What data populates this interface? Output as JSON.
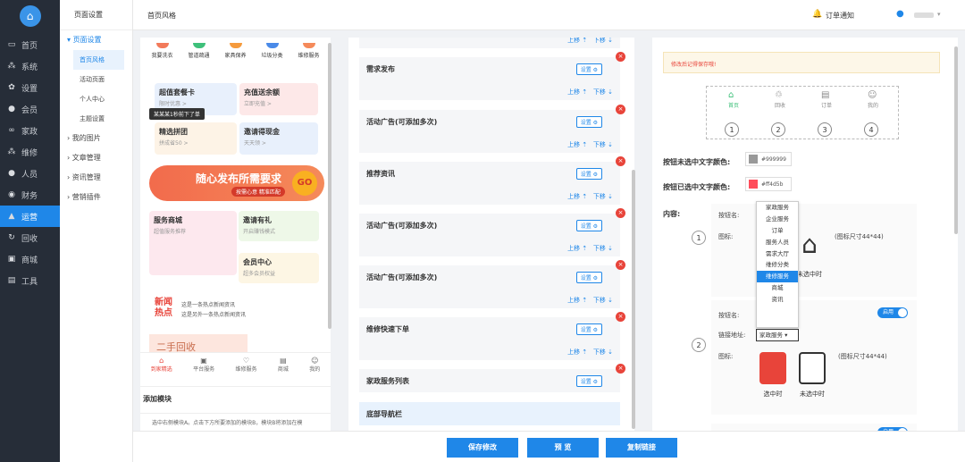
{
  "sidebar": {
    "items": [
      {
        "label": "首页",
        "icon": "monitor-icon"
      },
      {
        "label": "系统",
        "icon": "network-icon"
      },
      {
        "label": "设置",
        "icon": "gear-icon"
      },
      {
        "label": "会员",
        "icon": "user-icon"
      },
      {
        "label": "家政",
        "icon": "link-icon"
      },
      {
        "label": "维修",
        "icon": "network-icon"
      },
      {
        "label": "人员",
        "icon": "user-icon"
      },
      {
        "label": "财务",
        "icon": "finance-icon"
      },
      {
        "label": "运营",
        "icon": "chart-icon",
        "active": true
      },
      {
        "label": "回收",
        "icon": "recycle-icon"
      },
      {
        "label": "商城",
        "icon": "shop-icon"
      },
      {
        "label": "工具",
        "icon": "toolbox-icon"
      }
    ]
  },
  "subnav": {
    "header": "页面设置",
    "group_open": "页面设置",
    "sub_items": [
      "首页风格",
      "活动页面",
      "个人中心",
      "主题设置"
    ],
    "groups": [
      "我的图片",
      "文章管理",
      "资讯管理",
      "营销插件"
    ]
  },
  "topbar": {
    "title": "首页风格",
    "notice": "订单通知"
  },
  "preview": {
    "icons": [
      "我要洗衣",
      "管道疏通",
      "家具保养",
      "垃圾分类",
      "维修服务"
    ],
    "cards": [
      {
        "title": "超值套餐卡",
        "sub": "限时优惠 >"
      },
      {
        "title": "充值送余额",
        "sub": "立即充值 >"
      },
      {
        "title": "精选拼团",
        "sub": "拼成省50 >"
      },
      {
        "title": "邀请得现金",
        "sub": "天天领 >"
      }
    ],
    "tip": "某某某1秒前下了单",
    "banner_title": "随心发布所需要求",
    "banner_sub": "按需心意 精准匹配",
    "banner_go": "GO",
    "shop": {
      "title": "服务商城",
      "sub": "超值服务推荐"
    },
    "invite": {
      "title": "邀请有礼",
      "sub": "开启赚钱模式"
    },
    "member": {
      "title": "会员中心",
      "sub": "超多会员权益"
    },
    "news_label": "新闻热点",
    "news": [
      "这是一条热点新闻资讯",
      "这是另外一条热点新闻资讯"
    ],
    "secondhand": "二手回收",
    "tabbar": [
      "到家精选",
      "平台服务",
      "维修服务",
      "商城",
      "我的"
    ],
    "add_module": "添加模块",
    "add_desc": "选中右侧模块A。点击下方所要添加的模块B，模块B将添加在模"
  },
  "modules": {
    "set_label": "设置",
    "up_label": "上移",
    "down_label": "下移",
    "items": [
      "需求发布",
      "活动广告(可添加多次)",
      "推荐资讯",
      "活动广告(可添加多次)",
      "活动广告(可添加多次)",
      "维修快速下单",
      "家政服务列表",
      "底部导航栏"
    ]
  },
  "settings": {
    "warning": "修改后记得保存哦!",
    "tabs": [
      "首页",
      "回收",
      "订单",
      "我的"
    ],
    "unselected_label": "按钮未选中文字颜色:",
    "unselected_color": "#999999",
    "selected_label": "按钮已选中文字颜色:",
    "selected_color": "#ff4d5b",
    "content_label": "内容:",
    "btn_name_label": "按钮名:",
    "icon_label": "图标:",
    "link_label": "链接地址:",
    "icon_size": "(图标尺寸44*44)",
    "selected_cap": "选中时",
    "unselected_cap": "未选中时",
    "toggle": "启用",
    "dropdown": [
      "家政服务",
      "企业服务",
      "订单",
      "服务人员",
      "需求大厅",
      "维修分类",
      "维修服务",
      "商城",
      "资讯"
    ],
    "dropdown_selected": "维修服务",
    "link_value": "家政服务"
  },
  "footer": {
    "save": "保存修改",
    "preview": "预 览",
    "copy": "复制链接"
  }
}
